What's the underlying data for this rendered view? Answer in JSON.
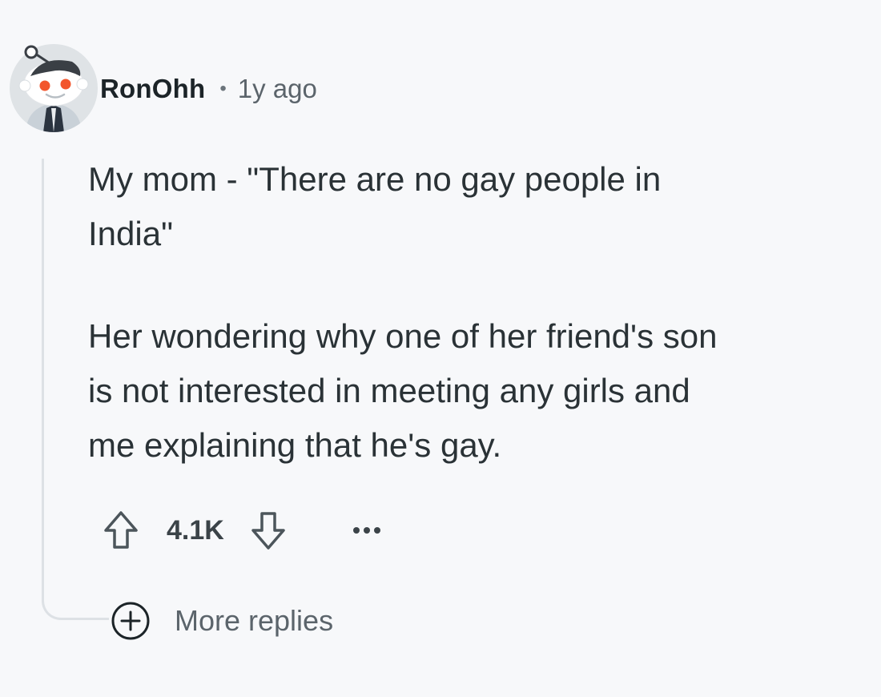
{
  "comment": {
    "username": "RonOhh",
    "separator": "•",
    "timestamp": "1y ago",
    "avatar_icon": "snoo-avatar-icon",
    "body": [
      "My mom - \"There are no gay people in\nIndia\"",
      "Her wondering why one of her friend's son\nis not interested in meeting any girls and\nme explaining that he's gay."
    ]
  },
  "actions": {
    "upvote_icon": "upvote-arrow-icon",
    "score": "4.1K",
    "downvote_icon": "downvote-arrow-icon",
    "more_icon": "ellipsis-icon"
  },
  "more_replies": {
    "icon": "plus-circle-icon",
    "label": "More replies"
  },
  "colors": {
    "background": "#f7f8fa",
    "text": "#2a3236",
    "muted": "#5b646b",
    "thread_line": "#dde1e5"
  }
}
